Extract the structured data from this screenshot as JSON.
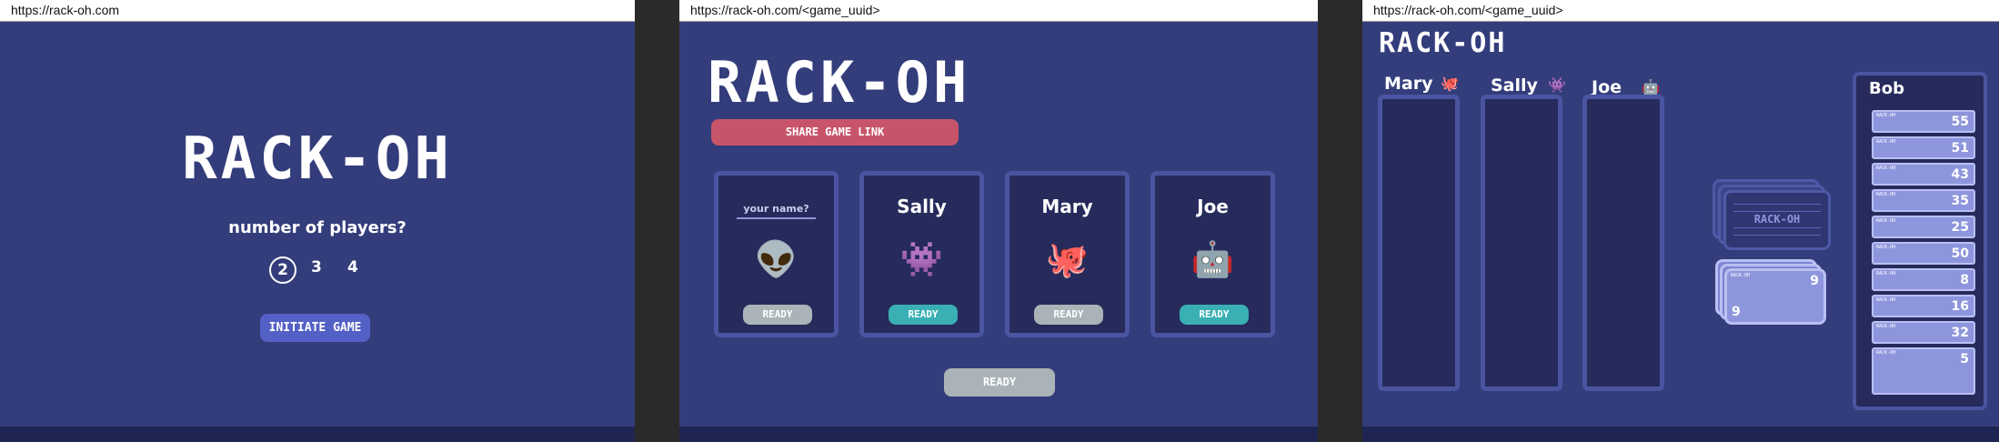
{
  "panel1": {
    "url": "https://rack-oh.com",
    "title": "RACK-OH",
    "question": "number of players?",
    "player_options": [
      "2",
      "3",
      "4"
    ],
    "selected": "2",
    "initiate_label": "INITIATE GAME"
  },
  "panel2": {
    "url": "https://rack-oh.com/<game_uuid>",
    "title": "RACK-OH",
    "share_label": "SHARE GAME LINK",
    "name_placeholder": "your name?",
    "players": [
      {
        "name": "",
        "emoji": "👽",
        "ready_label": "READY",
        "ready": false
      },
      {
        "name": "Sally",
        "emoji": "👾",
        "ready_label": "READY",
        "ready": true
      },
      {
        "name": "Mary",
        "emoji": "🐙",
        "ready_label": "READY",
        "ready": false
      },
      {
        "name": "Joe",
        "emoji": "🤖",
        "ready_label": "READY",
        "ready": true
      }
    ],
    "ready_label": "READY"
  },
  "panel3": {
    "url": "https://rack-oh.com/<game_uuid>",
    "title": "RACK-OH",
    "opponents": [
      {
        "name": "Mary",
        "emoji": "🐙"
      },
      {
        "name": "Sally",
        "emoji": "👾"
      },
      {
        "name": "Joe",
        "emoji": "🤖"
      }
    ],
    "deck_label": "RACK-OH",
    "discard_value": "9",
    "player": {
      "name": "Bob",
      "card_label": "RACK-OH",
      "rack": [
        "55",
        "51",
        "43",
        "35",
        "25",
        "50",
        "8",
        "16",
        "32",
        "5"
      ]
    }
  },
  "colors": {
    "background": "#343d7b",
    "card_bg": "#262b5c",
    "border": "#4a54a1",
    "share_button": "#c8546a",
    "initiate_button": "#5360c6",
    "ready_grey": "#aab4b8",
    "ready_teal": "#3ab0b5",
    "rack_card": "#8d96dd"
  }
}
